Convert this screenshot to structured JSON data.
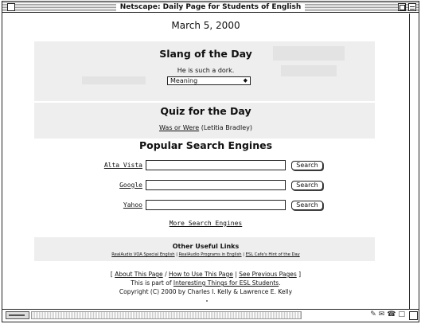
{
  "window": {
    "title": "Netscape: Daily Page for Students of English"
  },
  "page": {
    "date": "March 5, 2000",
    "slang": {
      "heading": "Slang of the Day",
      "sentence": "He is such a dork.",
      "select_value": "Meaning"
    },
    "quiz": {
      "heading": "Quiz for the Day",
      "link": "Was or Were",
      "author": "(Letitia Bradley)"
    },
    "search": {
      "heading": "Popular Search Engines",
      "engines": [
        {
          "label": "Alta Vista",
          "button": "Search"
        },
        {
          "label": "Google",
          "button": "Search"
        },
        {
          "label": "Yahoo",
          "button": "Search"
        }
      ],
      "more_link": "More Search Engines"
    },
    "links": {
      "title": "Other Useful Links",
      "items": [
        "RealAudio VOA Special English",
        "RealAudio Programs in English",
        "ESL Cafe's Hint of the Day"
      ],
      "separator": "|"
    },
    "footer": {
      "bracket_open": "[",
      "about_link": "About This Page",
      "slash": "/",
      "howto_link": "How to Use This Page",
      "separator": "|",
      "previous_link": "See Previous Pages",
      "bracket_close": "]",
      "part_of_prefix": "This is part of",
      "part_of_link": "Interesting Things for ESL Students",
      "part_of_suffix": ".",
      "copyright": "Copyright (C) 2000 by Charles I. Kelly & Lawrence E. Kelly"
    }
  }
}
